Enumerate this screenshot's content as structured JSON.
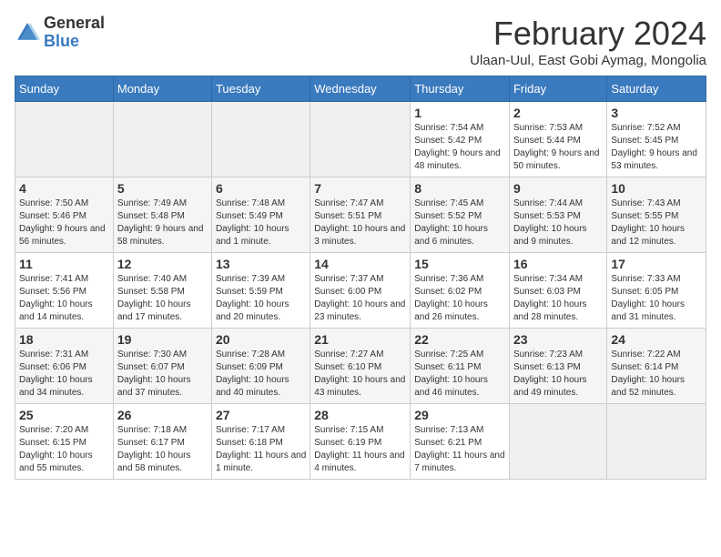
{
  "header": {
    "logo_general": "General",
    "logo_blue": "Blue",
    "title": "February 2024",
    "subtitle": "Ulaan-Uul, East Gobi Aymag, Mongolia"
  },
  "weekdays": [
    "Sunday",
    "Monday",
    "Tuesday",
    "Wednesday",
    "Thursday",
    "Friday",
    "Saturday"
  ],
  "weeks": [
    [
      {
        "day": "",
        "info": ""
      },
      {
        "day": "",
        "info": ""
      },
      {
        "day": "",
        "info": ""
      },
      {
        "day": "",
        "info": ""
      },
      {
        "day": "1",
        "info": "Sunrise: 7:54 AM\nSunset: 5:42 PM\nDaylight: 9 hours and 48 minutes."
      },
      {
        "day": "2",
        "info": "Sunrise: 7:53 AM\nSunset: 5:44 PM\nDaylight: 9 hours and 50 minutes."
      },
      {
        "day": "3",
        "info": "Sunrise: 7:52 AM\nSunset: 5:45 PM\nDaylight: 9 hours and 53 minutes."
      }
    ],
    [
      {
        "day": "4",
        "info": "Sunrise: 7:50 AM\nSunset: 5:46 PM\nDaylight: 9 hours and 56 minutes."
      },
      {
        "day": "5",
        "info": "Sunrise: 7:49 AM\nSunset: 5:48 PM\nDaylight: 9 hours and 58 minutes."
      },
      {
        "day": "6",
        "info": "Sunrise: 7:48 AM\nSunset: 5:49 PM\nDaylight: 10 hours and 1 minute."
      },
      {
        "day": "7",
        "info": "Sunrise: 7:47 AM\nSunset: 5:51 PM\nDaylight: 10 hours and 3 minutes."
      },
      {
        "day": "8",
        "info": "Sunrise: 7:45 AM\nSunset: 5:52 PM\nDaylight: 10 hours and 6 minutes."
      },
      {
        "day": "9",
        "info": "Sunrise: 7:44 AM\nSunset: 5:53 PM\nDaylight: 10 hours and 9 minutes."
      },
      {
        "day": "10",
        "info": "Sunrise: 7:43 AM\nSunset: 5:55 PM\nDaylight: 10 hours and 12 minutes."
      }
    ],
    [
      {
        "day": "11",
        "info": "Sunrise: 7:41 AM\nSunset: 5:56 PM\nDaylight: 10 hours and 14 minutes."
      },
      {
        "day": "12",
        "info": "Sunrise: 7:40 AM\nSunset: 5:58 PM\nDaylight: 10 hours and 17 minutes."
      },
      {
        "day": "13",
        "info": "Sunrise: 7:39 AM\nSunset: 5:59 PM\nDaylight: 10 hours and 20 minutes."
      },
      {
        "day": "14",
        "info": "Sunrise: 7:37 AM\nSunset: 6:00 PM\nDaylight: 10 hours and 23 minutes."
      },
      {
        "day": "15",
        "info": "Sunrise: 7:36 AM\nSunset: 6:02 PM\nDaylight: 10 hours and 26 minutes."
      },
      {
        "day": "16",
        "info": "Sunrise: 7:34 AM\nSunset: 6:03 PM\nDaylight: 10 hours and 28 minutes."
      },
      {
        "day": "17",
        "info": "Sunrise: 7:33 AM\nSunset: 6:05 PM\nDaylight: 10 hours and 31 minutes."
      }
    ],
    [
      {
        "day": "18",
        "info": "Sunrise: 7:31 AM\nSunset: 6:06 PM\nDaylight: 10 hours and 34 minutes."
      },
      {
        "day": "19",
        "info": "Sunrise: 7:30 AM\nSunset: 6:07 PM\nDaylight: 10 hours and 37 minutes."
      },
      {
        "day": "20",
        "info": "Sunrise: 7:28 AM\nSunset: 6:09 PM\nDaylight: 10 hours and 40 minutes."
      },
      {
        "day": "21",
        "info": "Sunrise: 7:27 AM\nSunset: 6:10 PM\nDaylight: 10 hours and 43 minutes."
      },
      {
        "day": "22",
        "info": "Sunrise: 7:25 AM\nSunset: 6:11 PM\nDaylight: 10 hours and 46 minutes."
      },
      {
        "day": "23",
        "info": "Sunrise: 7:23 AM\nSunset: 6:13 PM\nDaylight: 10 hours and 49 minutes."
      },
      {
        "day": "24",
        "info": "Sunrise: 7:22 AM\nSunset: 6:14 PM\nDaylight: 10 hours and 52 minutes."
      }
    ],
    [
      {
        "day": "25",
        "info": "Sunrise: 7:20 AM\nSunset: 6:15 PM\nDaylight: 10 hours and 55 minutes."
      },
      {
        "day": "26",
        "info": "Sunrise: 7:18 AM\nSunset: 6:17 PM\nDaylight: 10 hours and 58 minutes."
      },
      {
        "day": "27",
        "info": "Sunrise: 7:17 AM\nSunset: 6:18 PM\nDaylight: 11 hours and 1 minute."
      },
      {
        "day": "28",
        "info": "Sunrise: 7:15 AM\nSunset: 6:19 PM\nDaylight: 11 hours and 4 minutes."
      },
      {
        "day": "29",
        "info": "Sunrise: 7:13 AM\nSunset: 6:21 PM\nDaylight: 11 hours and 7 minutes."
      },
      {
        "day": "",
        "info": ""
      },
      {
        "day": "",
        "info": ""
      }
    ]
  ]
}
